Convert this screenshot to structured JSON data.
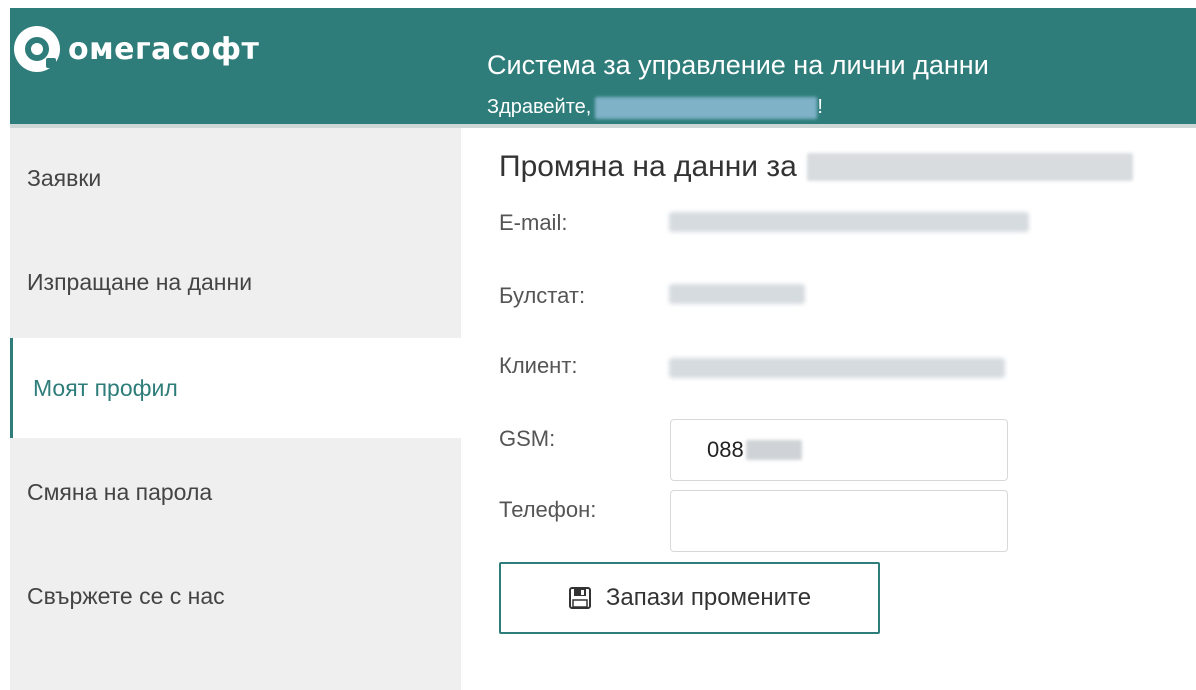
{
  "header": {
    "logo_text": "омегасофт",
    "title": "Система за управление на лични данни",
    "greeting_prefix": "Здравейте,",
    "greeting_suffix": "!"
  },
  "sidebar": {
    "items": [
      {
        "label": "Заявки",
        "active": false
      },
      {
        "label": "Изпращане на данни",
        "active": false
      },
      {
        "label": "Моят профил",
        "active": true
      },
      {
        "label": "Смяна на парола",
        "active": false
      },
      {
        "label": "Свържете се с нас",
        "active": false
      }
    ]
  },
  "main": {
    "title_prefix": "Промяна на данни за",
    "fields": {
      "email_label": "E-mail:",
      "bulstat_label": "Булстат:",
      "client_label": "Клиент:",
      "gsm_label": "GSM:",
      "phone_label": "Телефон:"
    },
    "gsm_value_prefix": "088",
    "phone_value": "",
    "save_label": "Запази промените"
  },
  "colors": {
    "brand": "#2e7d7a",
    "sidebar_bg": "#efefef"
  },
  "icons": {
    "logo": "omegasoft-logo-icon",
    "save": "floppy-disk-icon"
  }
}
